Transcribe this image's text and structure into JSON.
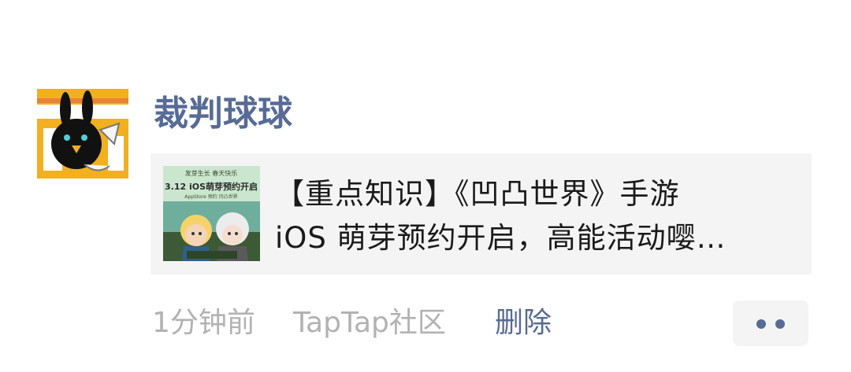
{
  "post": {
    "author": "裁判球球",
    "avatar_icon": "cartoon-rabbit-avatar",
    "link": {
      "thumbnail_text": {
        "slogan": "发芽生长 春天快乐",
        "headline": "3.12 iOS萌芽预约开启",
        "footer": "AppStore 预约 凹凸世界"
      },
      "title_lines": [
        "【重点知识】《凹凸世界》手游",
        "iOS 萌芽预约开启，高能活动嘤…"
      ]
    },
    "time": "1分钟前",
    "source": "TapTap社区",
    "delete_label": "删除",
    "more_icon": "more-dots-icon"
  },
  "colors": {
    "link_blue": "#576b95",
    "meta_gray": "#b2b2b2",
    "card_bg": "#f4f4f4"
  }
}
